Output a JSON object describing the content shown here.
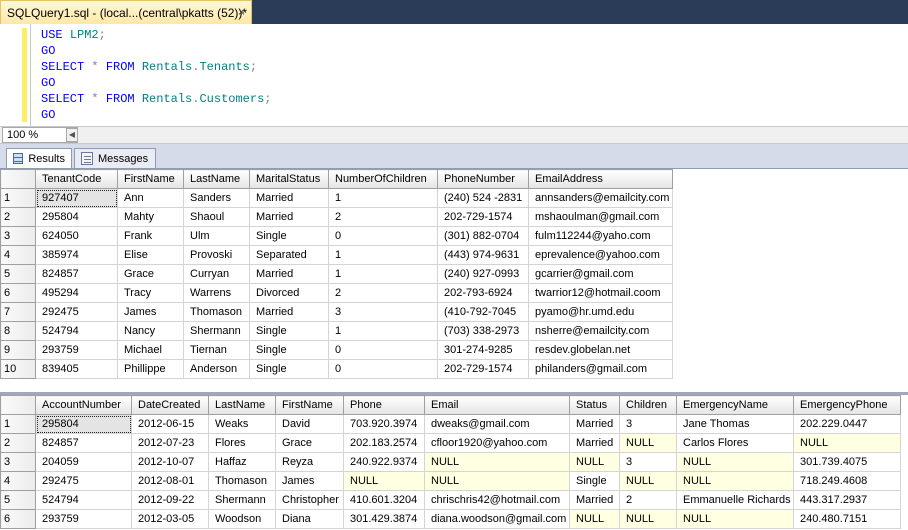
{
  "tab": {
    "title": "SQLQuery1.sql - (local...(central\\pkatts (52))*",
    "close": "×"
  },
  "editor": {
    "lines": [
      [
        [
          "kw",
          "USE"
        ],
        [
          "bk",
          " "
        ],
        [
          "id",
          "LPM2"
        ],
        [
          "op",
          ";"
        ]
      ],
      [
        [
          "kw",
          "GO"
        ]
      ],
      [
        [
          "kw",
          "SELECT"
        ],
        [
          "bk",
          " "
        ],
        [
          "op",
          "*"
        ],
        [
          "bk",
          " "
        ],
        [
          "kw",
          "FROM"
        ],
        [
          "bk",
          " "
        ],
        [
          "id",
          "Rentals"
        ],
        [
          "op",
          "."
        ],
        [
          "id",
          "Tenants"
        ],
        [
          "op",
          ";"
        ]
      ],
      [
        [
          "kw",
          "GO"
        ]
      ],
      [
        [
          "kw",
          "SELECT"
        ],
        [
          "bk",
          " "
        ],
        [
          "op",
          "*"
        ],
        [
          "bk",
          " "
        ],
        [
          "kw",
          "FROM"
        ],
        [
          "bk",
          " "
        ],
        [
          "id",
          "Rentals"
        ],
        [
          "op",
          "."
        ],
        [
          "id",
          "Customers"
        ],
        [
          "op",
          ";"
        ]
      ],
      [
        [
          "kw",
          "GO"
        ]
      ]
    ]
  },
  "zoom": {
    "value": "100 %"
  },
  "result_tabs": {
    "results": "Results",
    "messages": "Messages"
  },
  "colors": {
    "tab_bg": "#ffe8a6",
    "null_cell": "#ffffe1",
    "keyword": "#0000ff",
    "identifier": "#008080"
  },
  "grid1": {
    "columns": [
      "TenantCode",
      "FirstName",
      "LastName",
      "MaritalStatus",
      "NumberOfChildren",
      "PhoneNumber",
      "EmailAddress"
    ],
    "rows": [
      [
        "1",
        "927407",
        "Ann",
        "Sanders",
        "Married",
        "1",
        "(240) 524 -2831",
        "annsanders@emailcity.com"
      ],
      [
        "2",
        "295804",
        "Mahty",
        "Shaoul",
        "Married",
        "2",
        "202-729-1574",
        "mshaoulman@gmail.com"
      ],
      [
        "3",
        "624050",
        "Frank",
        "Ulm",
        "Single",
        "0",
        "(301) 882-0704",
        "fulm112244@yaho.com"
      ],
      [
        "4",
        "385974",
        "Elise",
        "Provoski",
        "Separated",
        "1",
        "(443) 974-9631",
        "eprevalence@yahoo.com"
      ],
      [
        "5",
        "824857",
        "Grace",
        "Curryan",
        "Married",
        "1",
        "(240) 927-0993",
        "gcarrier@gmail.com"
      ],
      [
        "6",
        "495294",
        "Tracy",
        "Warrens",
        "Divorced",
        "2",
        "202-793-6924",
        "twarrior12@hotmail.coom"
      ],
      [
        "7",
        "292475",
        "James",
        "Thomason",
        "Married",
        "3",
        "(410-792-7045",
        "pyamo@hr.umd.edu"
      ],
      [
        "8",
        "524794",
        "Nancy",
        "Shermann",
        "Single",
        "1",
        "(703) 338-2973",
        "nsherre@emailcity.com"
      ],
      [
        "9",
        "293759",
        "Michael",
        "Tiernan",
        "Single",
        "0",
        "301-274-9285",
        "resdev.globelan.net"
      ],
      [
        "10",
        "839405",
        "Phillippe",
        "Anderson",
        "Single",
        "0",
        "202-729-1574",
        "philanders@gmail.com"
      ]
    ]
  },
  "grid2": {
    "columns": [
      "AccountNumber",
      "DateCreated",
      "LastName",
      "FirstName",
      "Phone",
      "Email",
      "Status",
      "Children",
      "EmergencyName",
      "EmergencyPhone"
    ],
    "rows": [
      [
        "1",
        "295804",
        "2012-06-15",
        "Weaks",
        "David",
        "703.920.3974",
        "dweaks@gmail.com",
        "Married",
        "3",
        "Jane Thomas",
        "202.229.0447"
      ],
      [
        "2",
        "824857",
        "2012-07-23",
        "Flores",
        "Grace",
        "202.183.2574",
        "cfloor1920@yahoo.com",
        "Married",
        "NULL",
        "Carlos Flores",
        "NULL"
      ],
      [
        "3",
        "204059",
        "2012-10-07",
        "Haffaz",
        "Reyza",
        "240.922.9374",
        "NULL",
        "NULL",
        "3",
        "NULL",
        "301.739.4075"
      ],
      [
        "4",
        "292475",
        "2012-08-01",
        "Thomason",
        "James",
        "NULL",
        "NULL",
        "Single",
        "NULL",
        "NULL",
        "718.249.4608"
      ],
      [
        "5",
        "524794",
        "2012-09-22",
        "Shermann",
        "Christopher",
        "410.601.3204",
        "chrischris42@hotmail.com",
        "Married",
        "2",
        "Emmanuelle Richards",
        "443.317.2937"
      ],
      [
        "6",
        "293759",
        "2012-03-05",
        "Woodson",
        "Diana",
        "301.429.3874",
        "diana.woodson@gmail.com",
        "NULL",
        "NULL",
        "NULL",
        "240.480.7151"
      ]
    ]
  }
}
